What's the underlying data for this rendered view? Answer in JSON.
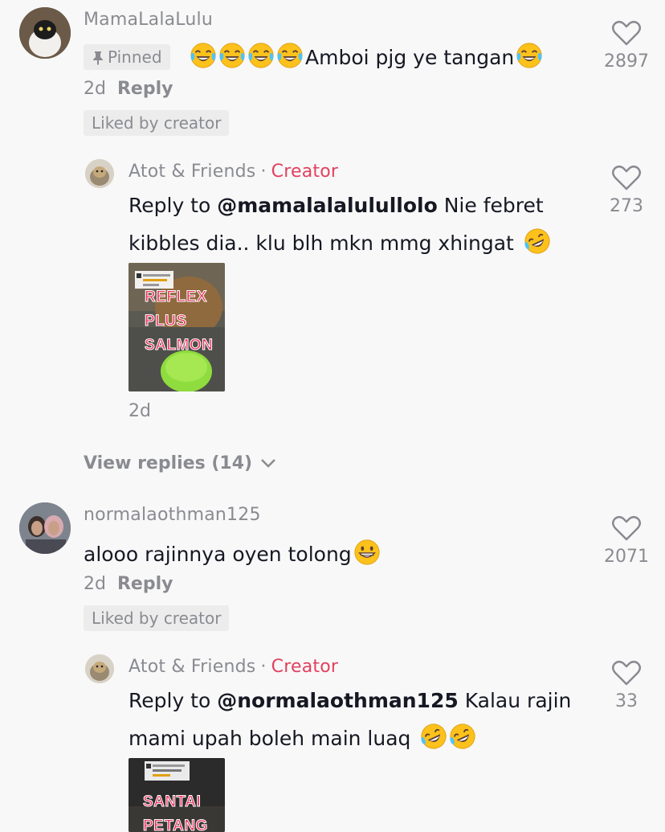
{
  "comments": [
    {
      "username": "MamaLalaLulu",
      "pinned_label": "Pinned",
      "text": "Amboi pjg ye tangan",
      "time": "2d",
      "reply_label": "Reply",
      "liked_label": "Liked by creator",
      "like_count": "2897",
      "reply": {
        "username": "Atot & Friends",
        "creator_dot": "·",
        "creator_label": "Creator",
        "reply_prefix": "Reply to",
        "mention": "@mamalalalulullolo",
        "text_line1": "Nie febret",
        "text_line2": "kibbles dia.. klu blh mkn mmg xhingat",
        "like_count": "273",
        "time": "2d",
        "thumbnail_lines": [
          "REFLEX",
          "PLUS",
          "SALMON"
        ]
      },
      "view_replies": "View replies (14)"
    },
    {
      "username": "normalaothman125",
      "text": "alooo rajinnya oyen tolong",
      "time": "2d",
      "reply_label": "Reply",
      "liked_label": "Liked by creator",
      "like_count": "2071",
      "reply": {
        "username": "Atot & Friends",
        "creator_dot": "·",
        "creator_label": "Creator",
        "reply_prefix": "Reply to",
        "mention": "@normalaothman125",
        "text_line1": "Kalau rajin",
        "text_line2": "mami upah boleh main luaq",
        "like_count": "33",
        "thumbnail_lines": [
          "SANTAI",
          "PETANG"
        ]
      }
    }
  ],
  "colors": {
    "background": "#f8f8f8",
    "muted_text": "#8a8b91",
    "creator_accent": "#e1415f",
    "tag_background": "#ececec"
  },
  "icons": [
    "heart-icon",
    "pin-icon",
    "chevron-down-icon",
    "tears-of-joy-emoji",
    "rolling-laughing-emoji",
    "grinning-emoji"
  ]
}
